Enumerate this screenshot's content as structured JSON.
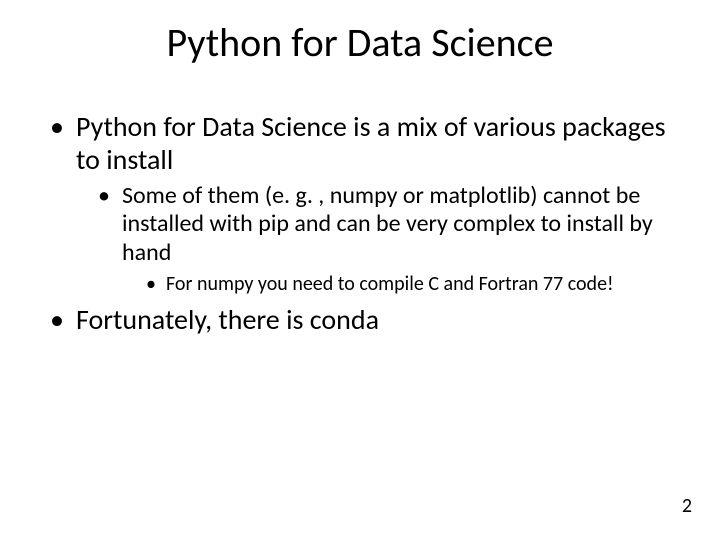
{
  "title": "Python for Data Science",
  "bullets": {
    "b1": "Python for Data Science is a mix of various packages to install",
    "b1_1": "Some of them (e. g. , numpy or matplotlib) cannot be installed with pip and can be very complex to install by hand",
    "b1_1_1": "For numpy you need to compile C and Fortran 77 code!",
    "b2": "Fortunately, there is conda"
  },
  "page_number": "2"
}
